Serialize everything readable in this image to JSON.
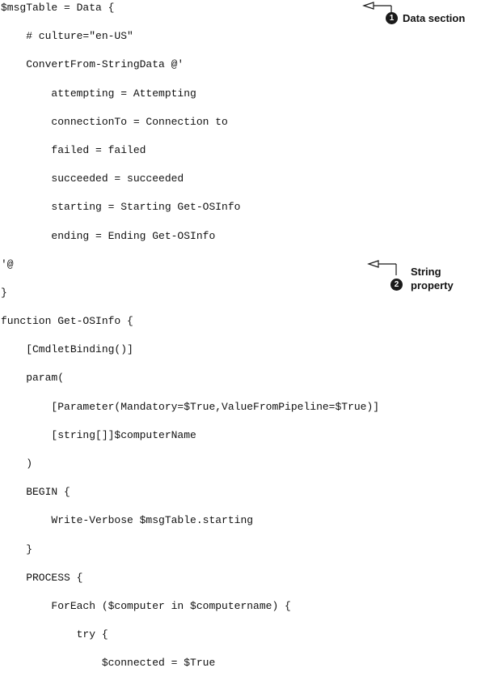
{
  "code_lines": [
    "$msgTable = Data {",
    "    # culture=\"en-US\"",
    "    ConvertFrom-StringData @'",
    "        attempting = Attempting",
    "        connectionTo = Connection to",
    "        failed = failed",
    "        succeeded = succeeded",
    "        starting = Starting Get-OSInfo",
    "        ending = Ending Get-OSInfo",
    "'@",
    "}",
    "function Get-OSInfo {",
    "    [CmdletBinding()]",
    "    param(",
    "        [Parameter(Mandatory=$True,ValueFromPipeline=$True)]",
    "        [string[]]$computerName",
    "    )",
    "    BEGIN {",
    "        Write-Verbose $msgTable.starting",
    "    }",
    "    PROCESS {",
    "        ForEach ($computer in $computername) {",
    "            try {",
    "                $connected = $True"
  ],
  "callouts": [
    {
      "number": "1",
      "label": "Data section"
    },
    {
      "number": "2",
      "label": "String\nproperty"
    }
  ]
}
